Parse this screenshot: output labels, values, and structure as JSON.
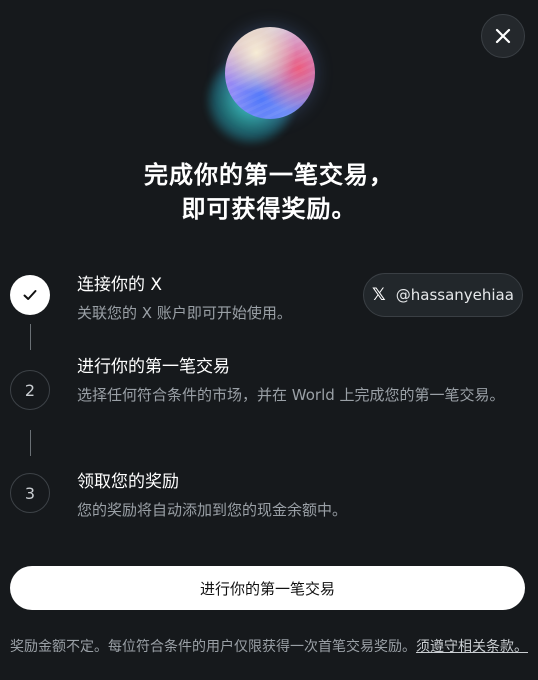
{
  "title_line1": "完成你的第一笔交易，",
  "title_line2": "即可获得奖励。",
  "steps": [
    {
      "number": "",
      "status": "done",
      "title": "连接你的 X",
      "description": "关联您的 X 账户即可开始使用。"
    },
    {
      "number": "2",
      "status": "pending",
      "title": "进行你的第一笔交易",
      "description": "选择任何符合条件的市场，并在 World 上完成您的第一笔交易。"
    },
    {
      "number": "3",
      "status": "pending",
      "title": "领取您的奖励",
      "description": "您的奖励将自动添加到您的现金余额中。"
    }
  ],
  "x_account": {
    "handle": "@hassanyehiaa",
    "icon": "x-logo-icon"
  },
  "cta_label": "进行你的第一笔交易",
  "footer": {
    "text": "奖励金额不定。每位符合条件的用户仅限获得一次首笔交易奖励。",
    "link": "须遵守相关条款。"
  },
  "icons": {
    "close": "close-icon",
    "check": "check-icon"
  }
}
